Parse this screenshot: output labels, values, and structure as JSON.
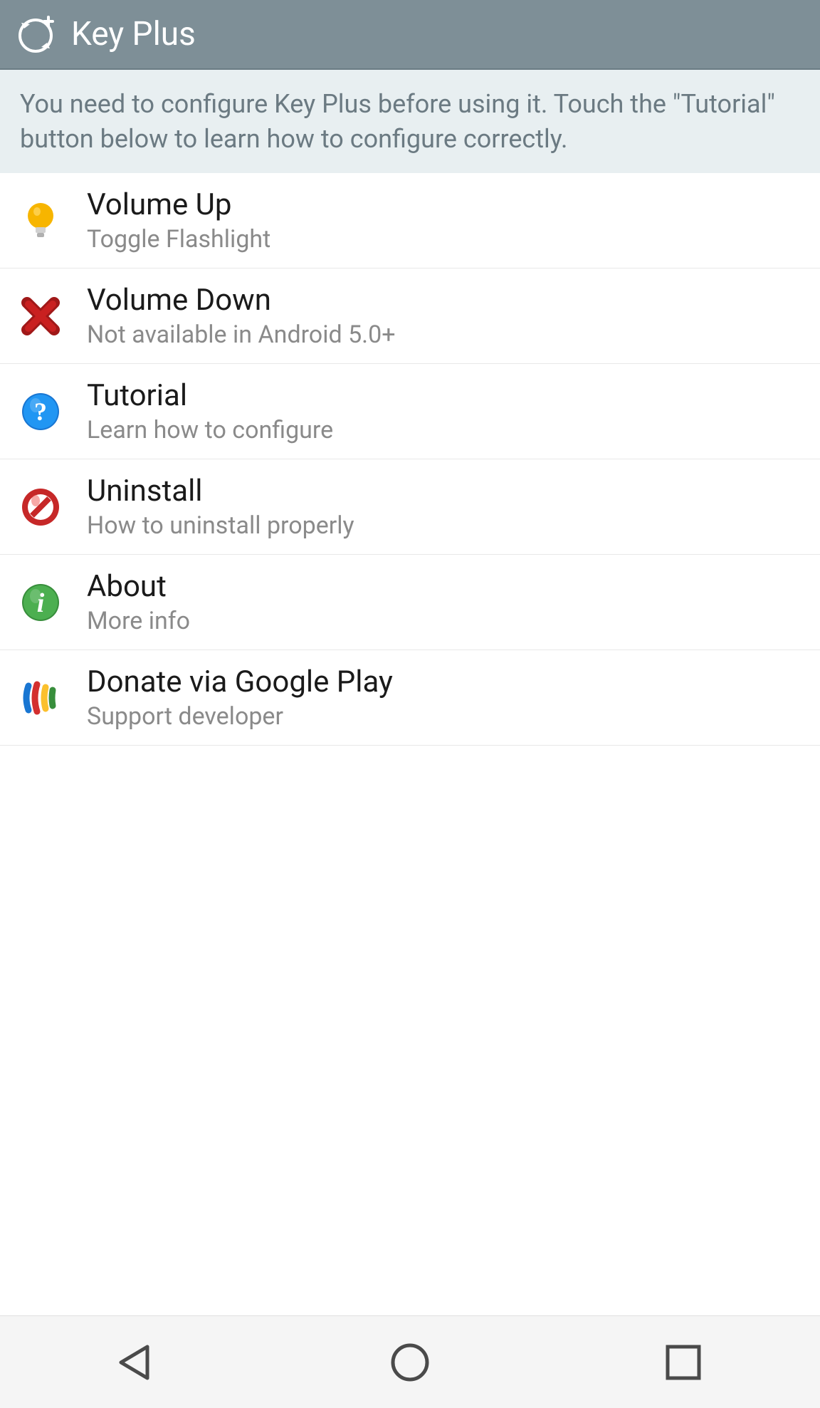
{
  "header": {
    "title": "Key Plus"
  },
  "banner": {
    "text": "You need to configure Key Plus before using it. Touch the \"Tutorial\" button below to learn how to configure correctly."
  },
  "list": {
    "items": [
      {
        "title": "Volume Up",
        "subtitle": "Toggle Flashlight",
        "icon": "lightbulb"
      },
      {
        "title": "Volume Down",
        "subtitle": "Not available in Android 5.0+",
        "icon": "x-red"
      },
      {
        "title": "Tutorial",
        "subtitle": "Learn how to configure",
        "icon": "help-blue"
      },
      {
        "title": "Uninstall",
        "subtitle": "How to uninstall properly",
        "icon": "prohibit-red"
      },
      {
        "title": "About",
        "subtitle": "More info",
        "icon": "info-green"
      },
      {
        "title": "Donate via Google Play",
        "subtitle": "Support developer",
        "icon": "wallet"
      }
    ]
  }
}
